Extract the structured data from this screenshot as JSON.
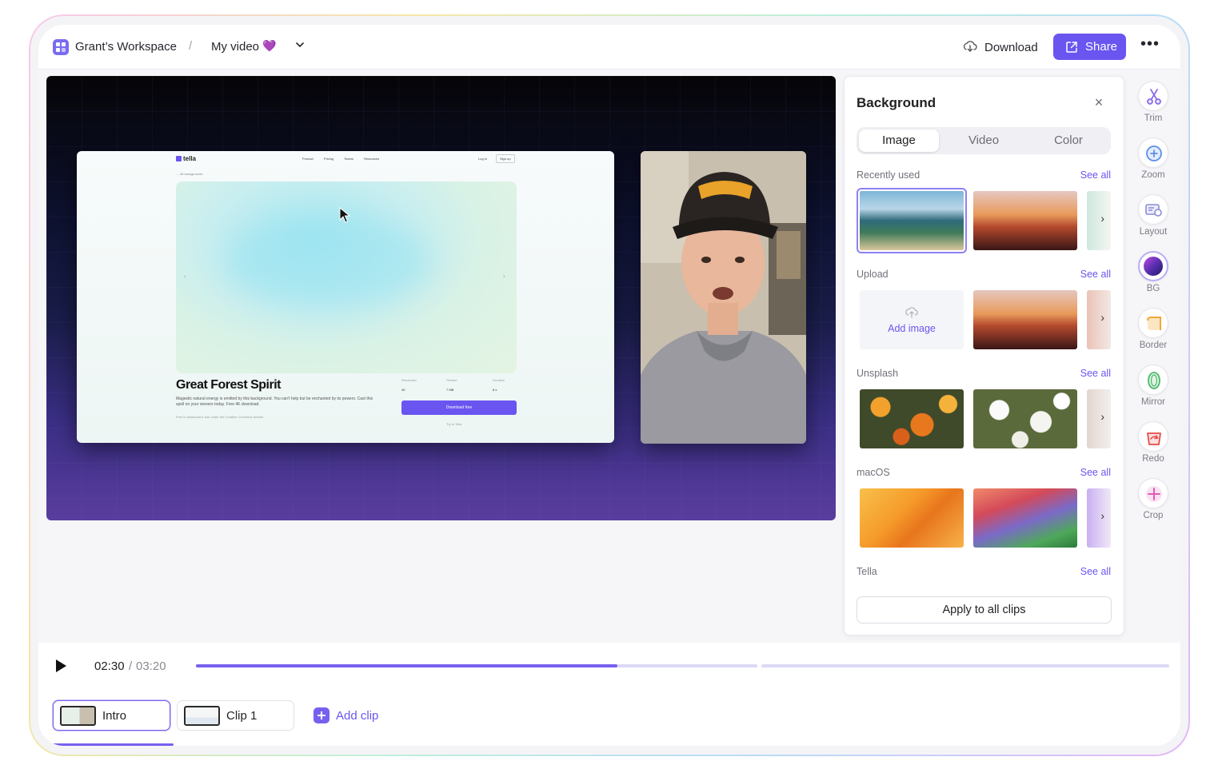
{
  "header": {
    "workspace": "Grant’s Workspace",
    "separator": "/",
    "video_title": "My video",
    "video_emoji": "💜",
    "download_label": "Download",
    "share_label": "Share"
  },
  "preview": {
    "screen": {
      "logo": "tella",
      "nav": [
        "Product",
        "Pricing",
        "Teams",
        "Resources"
      ],
      "login": "Log in",
      "signup": "Sign up",
      "back_link": "← All backgrounds",
      "title": "Great Forest Spirit",
      "description": "Magestic natural energy is emitted by this background. You can't help but be enchanted by its powers. Cast this spell on your viewers today. Free 4K download.",
      "license": "Free to download & use under the Creative Commons license",
      "meta": [
        {
          "label": "Resolution",
          "value": "4K"
        },
        {
          "label": "Filesize",
          "value": "7 MB"
        },
        {
          "label": "Duration",
          "value": "8 s"
        }
      ],
      "download_button": "Download free",
      "try_link": "Try in Tella"
    }
  },
  "panel": {
    "title": "Background",
    "tabs": [
      "Image",
      "Video",
      "Color"
    ],
    "active_tab": "Image",
    "sections": [
      {
        "label": "Recently used",
        "see_all": "See all"
      },
      {
        "label": "Upload",
        "see_all": "See all",
        "add_label": "Add image"
      },
      {
        "label": "Unsplash",
        "see_all": "See all"
      },
      {
        "label": "macOS",
        "see_all": "See all"
      },
      {
        "label": "Tella",
        "see_all": "See all"
      }
    ],
    "apply_label": "Apply to all clips"
  },
  "tools": [
    {
      "label": "Trim",
      "icon": "scissors-icon"
    },
    {
      "label": "Zoom",
      "icon": "zoom-icon"
    },
    {
      "label": "Layout",
      "icon": "layout-icon"
    },
    {
      "label": "BG",
      "icon": "background-icon"
    },
    {
      "label": "Border",
      "icon": "border-icon"
    },
    {
      "label": "Mirror",
      "icon": "mirror-icon"
    },
    {
      "label": "Redo",
      "icon": "redo-icon"
    },
    {
      "label": "Crop",
      "icon": "crop-icon"
    }
  ],
  "playback": {
    "current_time": "02:30",
    "separator": "/",
    "total_time": "03:20",
    "progress": 0.75
  },
  "clips": [
    {
      "label": "Intro",
      "active": true
    },
    {
      "label": "Clip 1",
      "active": false
    }
  ],
  "add_clip_label": "Add clip",
  "colors": {
    "accent": "#6a55f0",
    "track": "#dcd9f6"
  }
}
